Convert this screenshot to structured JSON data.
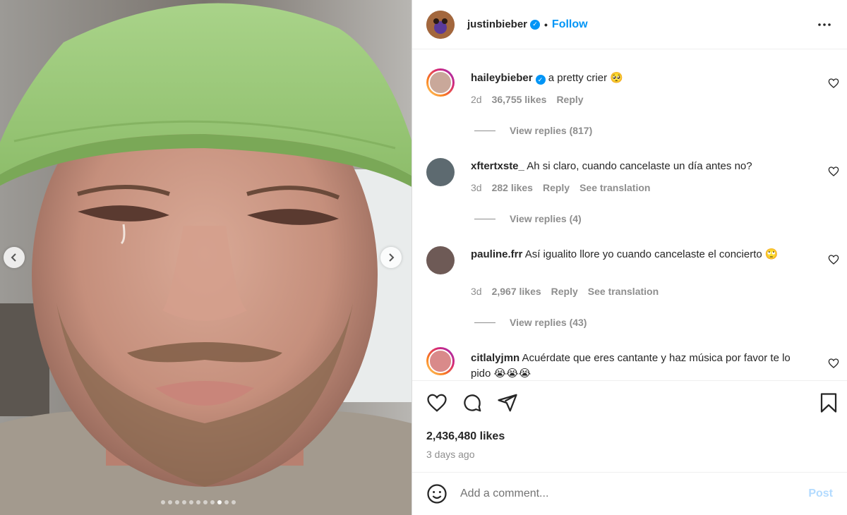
{
  "post": {
    "author": "justinbieber",
    "separator": "•",
    "follow_label": "Follow",
    "more_icon": "more-horizontal-icon"
  },
  "comments": [
    {
      "username": "haileybieber",
      "verified": true,
      "text": "a pretty crier 🥺",
      "age": "2d",
      "likes": "36,755 likes",
      "reply_label": "Reply",
      "translation_label": "",
      "view_replies": "View replies (817)"
    },
    {
      "username": "xftertxste_",
      "verified": false,
      "text": "Ah si claro, cuando cancelaste un día antes no?",
      "age": "3d",
      "likes": "282 likes",
      "reply_label": "Reply",
      "translation_label": "See translation",
      "view_replies": "View replies (4)"
    },
    {
      "username": "pauline.frr",
      "verified": false,
      "text": "Así igualito llore yo cuando cancelaste el concierto 🙄",
      "age": "3d",
      "likes": "2,967 likes",
      "reply_label": "Reply",
      "translation_label": "See translation",
      "view_replies": "View replies (43)"
    },
    {
      "username": "citlalyjmn",
      "verified": false,
      "text": "Acuérdate que eres cantante y haz música por favor te lo pido 😭😭😭"
    }
  ],
  "stats": {
    "likes": "2,436,480 likes",
    "posted": "3 days ago"
  },
  "composer": {
    "placeholder": "Add a comment...",
    "post_label": "Post"
  },
  "carousel": {
    "total_slides": 11,
    "active_slide": 9
  },
  "colors": {
    "accent": "#0095f6",
    "muted": "#8e8e8e",
    "post_disabled": "#b3dbff"
  }
}
